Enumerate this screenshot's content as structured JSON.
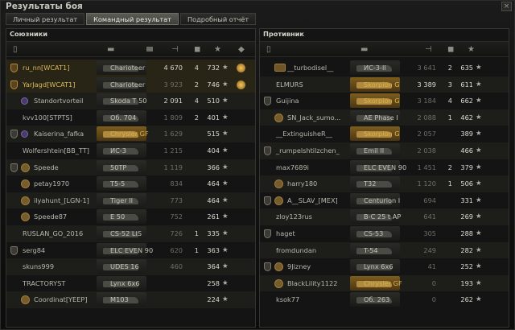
{
  "window": {
    "title": "Результаты боя",
    "close_label": "×"
  },
  "tabs": [
    {
      "label": "Личный результат",
      "active": false
    },
    {
      "label": "Командный результат",
      "active": true
    },
    {
      "label": "Подробный отчёт",
      "active": false
    }
  ],
  "allies": {
    "title": "Союзники",
    "rows": [
      {
        "icon": "gold",
        "ach": "",
        "name": "ru_nn[WCAT1]",
        "tank": "Charioteer",
        "prem": false,
        "damage": "4 670",
        "frags": "4",
        "exp": "732",
        "self": true,
        "hl": false,
        "damage_bright": true,
        "extra": "spark"
      },
      {
        "icon": "gold",
        "ach": "",
        "name": "YarJagd[WCAT1]",
        "tank": "Charioteer",
        "prem": false,
        "damage": "3 923",
        "frags": "2",
        "exp": "746",
        "self": true,
        "hl": false,
        "damage_bright": false,
        "extra": "spark"
      },
      {
        "icon": "",
        "ach": "purple",
        "name": "Standortvorteil",
        "tank": "Skoda T 50",
        "prem": false,
        "damage": "2 091",
        "frags": "4",
        "exp": "510",
        "self": false,
        "hl": true,
        "damage_bright": true,
        "extra": ""
      },
      {
        "icon": "",
        "ach": "",
        "name": "kvv100[STPTS]",
        "tank": "Об. 704",
        "prem": false,
        "damage": "1 809",
        "frags": "2",
        "exp": "401",
        "self": false,
        "hl": false,
        "damage_bright": false,
        "extra": ""
      },
      {
        "icon": "grey",
        "ach": "purple",
        "name": "Kaiserina_fafka",
        "tank": "Chrysler GF",
        "prem": true,
        "damage": "1 629",
        "frags": "",
        "exp": "515",
        "self": false,
        "hl": true,
        "damage_bright": false,
        "extra": ""
      },
      {
        "icon": "",
        "ach": "",
        "name": "Wolfershtein[BB_TT]",
        "tank": "ИС-3",
        "prem": false,
        "damage": "1 215",
        "frags": "",
        "exp": "404",
        "self": false,
        "hl": false,
        "damage_bright": false,
        "extra": ""
      },
      {
        "icon": "grey",
        "ach": "star",
        "name": "Speede",
        "tank": "50TP",
        "prem": false,
        "damage": "1 119",
        "frags": "",
        "exp": "366",
        "self": false,
        "hl": true,
        "damage_bright": false,
        "extra": ""
      },
      {
        "icon": "",
        "ach": "star",
        "name": "petay1970",
        "tank": "T5-5",
        "prem": false,
        "damage": "834",
        "frags": "",
        "exp": "464",
        "self": false,
        "hl": false,
        "damage_bright": false,
        "extra": ""
      },
      {
        "icon": "",
        "ach": "star",
        "name": "ilyahunt_[LGN-1]",
        "tank": "Tiger II",
        "prem": false,
        "damage": "773",
        "frags": "",
        "exp": "464",
        "self": false,
        "hl": true,
        "damage_bright": false,
        "extra": ""
      },
      {
        "icon": "",
        "ach": "star",
        "name": "Speede87",
        "tank": "E 50",
        "prem": false,
        "damage": "752",
        "frags": "",
        "exp": "261",
        "self": false,
        "hl": false,
        "damage_bright": false,
        "extra": ""
      },
      {
        "icon": "",
        "ach": "",
        "name": "RUSLAN_GO_2016",
        "tank": "CS-52 LIS",
        "prem": false,
        "damage": "726",
        "frags": "1",
        "exp": "335",
        "self": false,
        "hl": true,
        "damage_bright": false,
        "extra": ""
      },
      {
        "icon": "grey",
        "ach": "",
        "name": "serg84",
        "tank": "ELC EVEN 90",
        "prem": false,
        "damage": "620",
        "frags": "1",
        "exp": "363",
        "self": false,
        "hl": false,
        "damage_bright": false,
        "extra": ""
      },
      {
        "icon": "",
        "ach": "",
        "name": "skuns999",
        "tank": "UDES 16",
        "prem": false,
        "damage": "460",
        "frags": "",
        "exp": "364",
        "self": false,
        "hl": true,
        "damage_bright": false,
        "extra": ""
      },
      {
        "icon": "",
        "ach": "",
        "name": "TRACTORYST",
        "tank": "Lynx 6x6",
        "prem": false,
        "damage": "",
        "frags": "",
        "exp": "258",
        "self": false,
        "hl": false,
        "damage_bright": false,
        "extra": ""
      },
      {
        "icon": "",
        "ach": "star",
        "name": "Coordinat[YEEP]",
        "tank": "M103",
        "prem": false,
        "damage": "",
        "frags": "",
        "exp": "224",
        "self": false,
        "hl": true,
        "damage_bright": false,
        "extra": ""
      }
    ]
  },
  "enemies": {
    "title": "Противник",
    "rows": [
      {
        "icon": "",
        "ach": "gold",
        "name": "__turbodisel__",
        "tank": "ИС-3-II",
        "prem": false,
        "damage": "3 641",
        "frags": "2",
        "exp": "635",
        "self": false,
        "hl": false,
        "damage_bright": false,
        "extra": ""
      },
      {
        "icon": "",
        "ach": "",
        "name": "ELMURS",
        "tank": "Skorpion G",
        "prem": true,
        "damage": "3 389",
        "frags": "3",
        "exp": "611",
        "self": false,
        "hl": true,
        "damage_bright": true,
        "extra": ""
      },
      {
        "icon": "grey",
        "ach": "",
        "name": "Guijina",
        "tank": "Skorpion G",
        "prem": true,
        "damage": "3 184",
        "frags": "4",
        "exp": "662",
        "self": false,
        "hl": false,
        "damage_bright": false,
        "extra": ""
      },
      {
        "icon": "",
        "ach": "star",
        "name": "SN_Jack_sumo...",
        "tank": "AE Phase I",
        "prem": false,
        "damage": "2 088",
        "frags": "1",
        "exp": "462",
        "self": false,
        "hl": true,
        "damage_bright": false,
        "extra": ""
      },
      {
        "icon": "",
        "ach": "",
        "name": "__ExtinguisheR__",
        "tank": "Skorpion G",
        "prem": true,
        "damage": "2 057",
        "frags": "",
        "exp": "389",
        "self": false,
        "hl": false,
        "damage_bright": false,
        "extra": ""
      },
      {
        "icon": "grey",
        "ach": "",
        "name": "_rumpelshtilzchen_",
        "tank": "Emil II",
        "prem": false,
        "damage": "2 038",
        "frags": "",
        "exp": "466",
        "self": false,
        "hl": true,
        "damage_bright": false,
        "extra": ""
      },
      {
        "icon": "",
        "ach": "",
        "name": "max7689i",
        "tank": "ELC EVEN 90",
        "prem": false,
        "damage": "1 451",
        "frags": "2",
        "exp": "379",
        "self": false,
        "hl": false,
        "damage_bright": false,
        "extra": ""
      },
      {
        "icon": "",
        "ach": "star",
        "name": "harry180",
        "tank": "T32",
        "prem": false,
        "damage": "1 120",
        "frags": "1",
        "exp": "506",
        "self": false,
        "hl": true,
        "damage_bright": false,
        "extra": ""
      },
      {
        "icon": "grey",
        "ach": "star",
        "name": "A__SLAV_[MEX]",
        "tank": "Centurion I",
        "prem": false,
        "damage": "694",
        "frags": "",
        "exp": "331",
        "self": false,
        "hl": false,
        "damage_bright": false,
        "extra": ""
      },
      {
        "icon": "",
        "ach": "",
        "name": "zloy123rus",
        "tank": "B-C 25 t AP",
        "prem": false,
        "damage": "641",
        "frags": "",
        "exp": "269",
        "self": false,
        "hl": true,
        "damage_bright": false,
        "extra": ""
      },
      {
        "icon": "grey",
        "ach": "",
        "name": "haget",
        "tank": "CS-53",
        "prem": false,
        "damage": "305",
        "frags": "",
        "exp": "288",
        "self": false,
        "hl": false,
        "damage_bright": false,
        "extra": ""
      },
      {
        "icon": "",
        "ach": "",
        "name": "fromdundan",
        "tank": "T-54",
        "prem": false,
        "damage": "249",
        "frags": "",
        "exp": "282",
        "self": false,
        "hl": true,
        "damage_bright": false,
        "extra": ""
      },
      {
        "icon": "grey",
        "ach": "star",
        "name": "9Jizney",
        "tank": "Lynx 6x6",
        "prem": false,
        "damage": "41",
        "frags": "",
        "exp": "252",
        "self": false,
        "hl": false,
        "damage_bright": false,
        "extra": ""
      },
      {
        "icon": "",
        "ach": "star",
        "name": "BlackLility1122",
        "tank": "Chrysler GF",
        "prem": true,
        "damage": "0",
        "frags": "",
        "exp": "193",
        "self": false,
        "hl": true,
        "damage_bright": false,
        "extra": ""
      },
      {
        "icon": "",
        "ach": "",
        "name": "ksok77",
        "tank": "Об. 263",
        "prem": false,
        "damage": "0",
        "frags": "",
        "exp": "262",
        "self": false,
        "hl": false,
        "damage_bright": false,
        "extra": ""
      }
    ]
  },
  "columns": {
    "star_glyph": "★"
  }
}
